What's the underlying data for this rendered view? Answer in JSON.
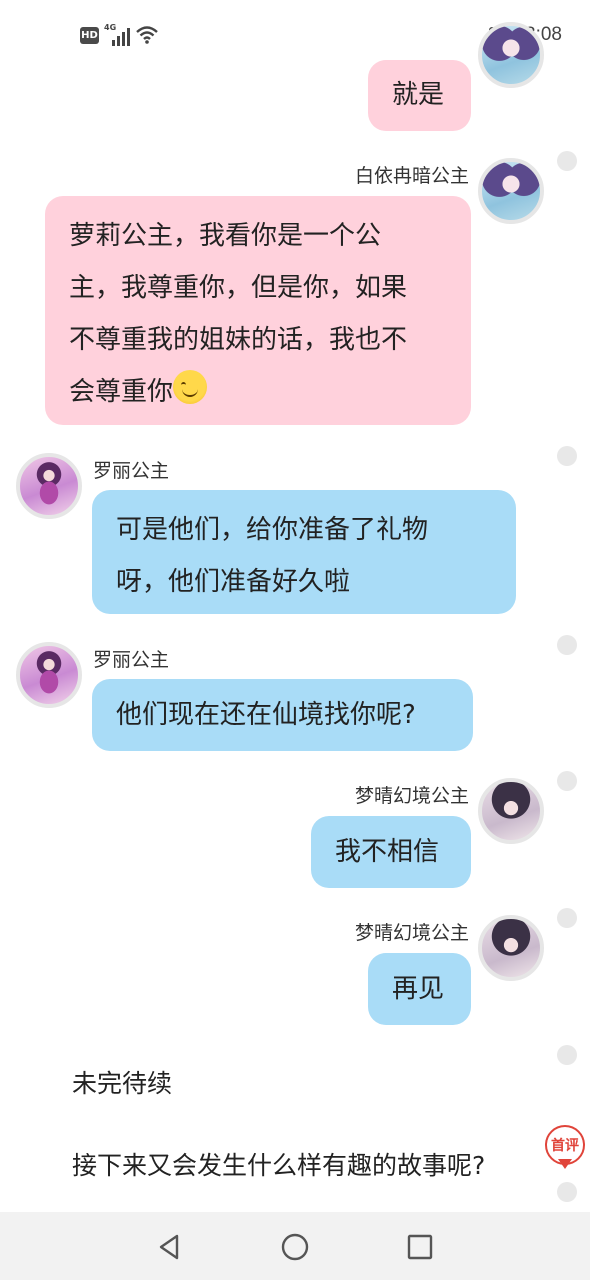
{
  "status_bar": {
    "hd_label": "HD",
    "network_label": "4G",
    "time": "3:08"
  },
  "messages": [
    {
      "side": "right",
      "sender": "",
      "text": "就是",
      "color": "#ffd1dc"
    },
    {
      "side": "right",
      "sender": "白依冉暗公主",
      "text_lines": [
        "萝莉公主，我看你是一个公",
        "主，我尊重你，但是你，如果",
        "不尊重我的姐妹的话，我也不",
        "会尊重你"
      ],
      "emoji": "smiling-face",
      "color": "#ffd1dc"
    },
    {
      "side": "left",
      "sender": "罗丽公主",
      "text_lines": [
        "可是他们，给你准备了礼物",
        "呀，他们准备好久啦"
      ],
      "color": "#a9dcf7"
    },
    {
      "side": "left",
      "sender": "罗丽公主",
      "text": "他们现在还在仙境找你呢?",
      "color": "#a9dcf7"
    },
    {
      "side": "right",
      "sender": "梦晴幻境公主",
      "text": "我不相信",
      "color": "#a9dcf7"
    },
    {
      "side": "right",
      "sender": "梦晴幻境公主",
      "text": "再见",
      "color": "#a9dcf7"
    }
  ],
  "story": {
    "line1": "未完待续",
    "line2": "接下来又会发生什么样有趣的故事呢?"
  },
  "review_badge": {
    "label": "首评",
    "color": "#e0443a"
  },
  "nav_bar": {
    "icons": [
      "back-triangle",
      "home-circle",
      "recent-square"
    ]
  }
}
